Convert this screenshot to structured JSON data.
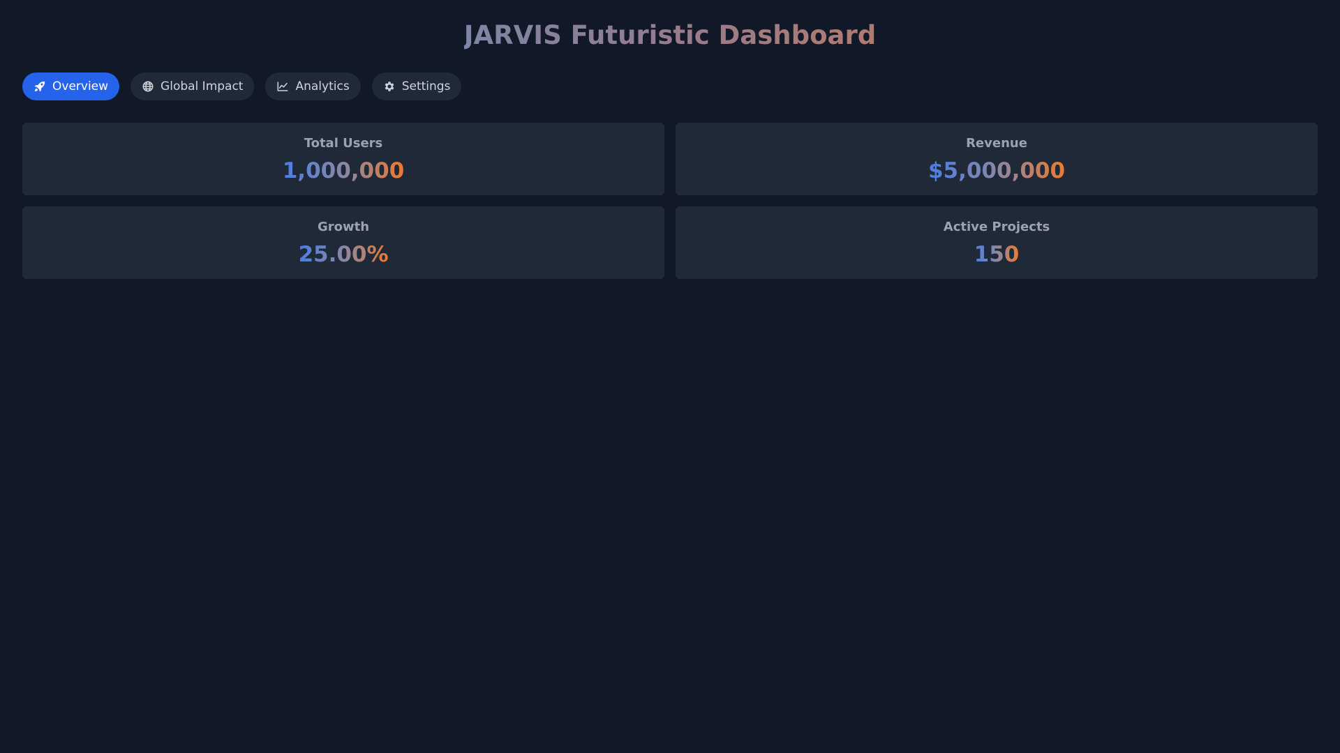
{
  "header": {
    "title": "JARVIS Futuristic Dashboard"
  },
  "tabs": [
    {
      "label": "Overview",
      "icon": "rocket-icon",
      "active": true
    },
    {
      "label": "Global Impact",
      "icon": "globe-icon",
      "active": false
    },
    {
      "label": "Analytics",
      "icon": "chart-line-icon",
      "active": false
    },
    {
      "label": "Settings",
      "icon": "gear-icon",
      "active": false
    }
  ],
  "stats": [
    {
      "label": "Total Users",
      "value": "1,000,000"
    },
    {
      "label": "Revenue",
      "value": "$5,000,000"
    },
    {
      "label": "Growth",
      "value": "25.00%"
    },
    {
      "label": "Active Projects",
      "value": "150"
    }
  ],
  "colors": {
    "background": "#111827",
    "card": "#1f2937",
    "accent": "#2563eb",
    "gradient_start": "#4a7de6",
    "gradient_end": "#ee7a2c"
  }
}
